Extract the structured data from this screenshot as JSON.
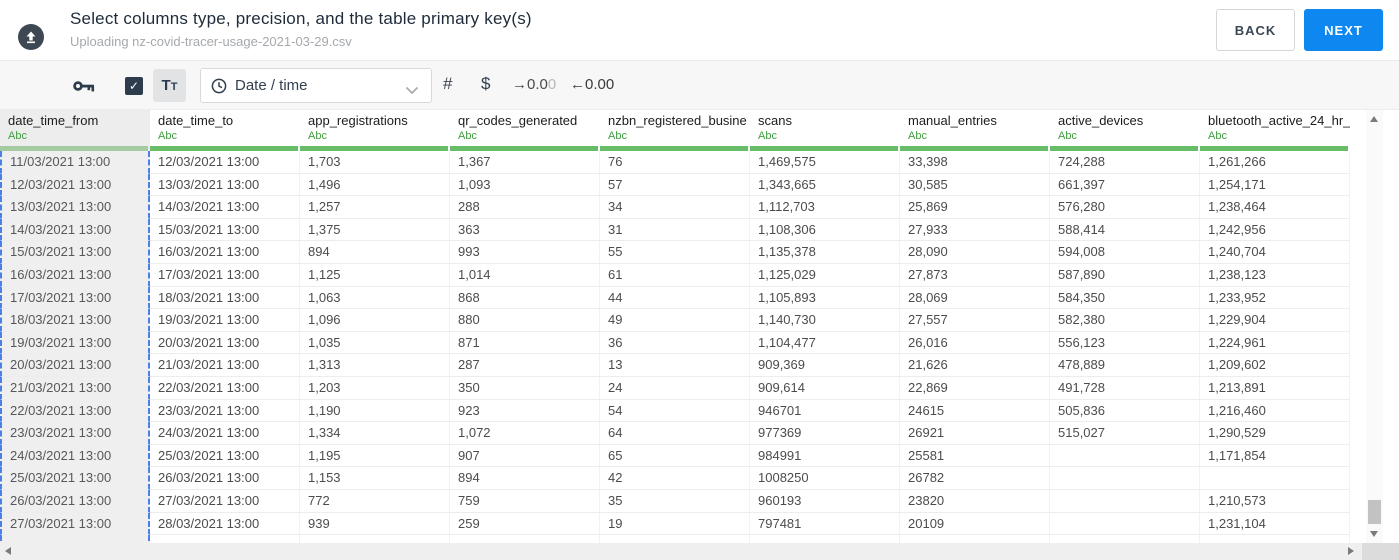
{
  "header": {
    "title": "Select columns type, precision, and the table primary key(s)",
    "subtitle": "Uploading nz-covid-tracer-usage-2021-03-29.csv",
    "back_label": "BACK",
    "next_label": "NEXT"
  },
  "toolbar": {
    "primary_key_checkbox_checked": true,
    "text_button_label": "Tt",
    "type_selector_value": "Date / time",
    "number_label": "#",
    "currency_label": "$",
    "decimal_increase_main": "→0.0",
    "decimal_increase_faded": "0",
    "decimal_decrease": "←0.00"
  },
  "icons": {
    "upload": "upload-arrow-in-circle",
    "primary_key": "key",
    "checkbox_check": "✓",
    "type_selector": "clock",
    "dropdown": "chevron-down"
  },
  "colors": {
    "accent_blue": "#0e87f1",
    "selection_blue": "#4a80e8",
    "type_green": "#3f9e3f",
    "bar_green": "#68bd68",
    "bar_green_selected": "#a5cba2",
    "dark_navy": "#2e3d4e"
  },
  "table": {
    "selected_column_index": 0,
    "columns": [
      {
        "name": "date_time_from",
        "type_label": "Abc"
      },
      {
        "name": "date_time_to",
        "type_label": "Abc"
      },
      {
        "name": "app_registrations",
        "type_label": "Abc"
      },
      {
        "name": "qr_codes_generated",
        "type_label": "Abc"
      },
      {
        "name": "nzbn_registered_busine",
        "type_label": "Abc"
      },
      {
        "name": "scans",
        "type_label": "Abc"
      },
      {
        "name": "manual_entries",
        "type_label": "Abc"
      },
      {
        "name": "active_devices",
        "type_label": "Abc"
      },
      {
        "name": "bluetooth_active_24_hr_",
        "type_label": "Abc"
      }
    ],
    "rows": [
      [
        "11/03/2021 13:00",
        "12/03/2021 13:00",
        "1,703",
        "1,367",
        "76",
        "1,469,575",
        "33,398",
        "724,288",
        "1,261,266"
      ],
      [
        "12/03/2021 13:00",
        "13/03/2021 13:00",
        "1,496",
        "1,093",
        "57",
        "1,343,665",
        "30,585",
        "661,397",
        "1,254,171"
      ],
      [
        "13/03/2021 13:00",
        "14/03/2021 13:00",
        "1,257",
        "288",
        "34",
        "1,112,703",
        "25,869",
        "576,280",
        "1,238,464"
      ],
      [
        "14/03/2021 13:00",
        "15/03/2021 13:00",
        "1,375",
        "363",
        "31",
        "1,108,306",
        "27,933",
        "588,414",
        "1,242,956"
      ],
      [
        "15/03/2021 13:00",
        "16/03/2021 13:00",
        "894",
        "993",
        "55",
        "1,135,378",
        "28,090",
        "594,008",
        "1,240,704"
      ],
      [
        "16/03/2021 13:00",
        "17/03/2021 13:00",
        "1,125",
        "1,014",
        "61",
        "1,125,029",
        "27,873",
        "587,890",
        "1,238,123"
      ],
      [
        "17/03/2021 13:00",
        "18/03/2021 13:00",
        "1,063",
        "868",
        "44",
        "1,105,893",
        "28,069",
        "584,350",
        "1,233,952"
      ],
      [
        "18/03/2021 13:00",
        "19/03/2021 13:00",
        "1,096",
        "880",
        "49",
        "1,140,730",
        "27,557",
        "582,380",
        "1,229,904"
      ],
      [
        "19/03/2021 13:00",
        "20/03/2021 13:00",
        "1,035",
        "871",
        "36",
        "1,104,477",
        "26,016",
        "556,123",
        "1,224,961"
      ],
      [
        "20/03/2021 13:00",
        "21/03/2021 13:00",
        "1,313",
        "287",
        "13",
        "909,369",
        "21,626",
        "478,889",
        "1,209,602"
      ],
      [
        "21/03/2021 13:00",
        "22/03/2021 13:00",
        "1,203",
        "350",
        "24",
        "909,614",
        "22,869",
        "491,728",
        "1,213,891"
      ],
      [
        "22/03/2021 13:00",
        "23/03/2021 13:00",
        "1,190",
        "923",
        "54",
        "946701",
        "24615",
        "505,836",
        "1,216,460"
      ],
      [
        "23/03/2021 13:00",
        "24/03/2021 13:00",
        "1,334",
        "1,072",
        "64",
        "977369",
        "26921",
        "515,027",
        "1,290,529"
      ],
      [
        "24/03/2021 13:00",
        "25/03/2021 13:00",
        "1,195",
        "907",
        "65",
        "984991",
        "25581",
        "",
        "1,171,854"
      ],
      [
        "25/03/2021 13:00",
        "26/03/2021 13:00",
        "1,153",
        "894",
        "42",
        "1008250",
        "26782",
        "",
        ""
      ],
      [
        "26/03/2021 13:00",
        "27/03/2021 13:00",
        "772",
        "759",
        "35",
        "960193",
        "23820",
        "",
        "1,210,573"
      ],
      [
        "27/03/2021 13:00",
        "28/03/2021 13:00",
        "939",
        "259",
        "19",
        "797481",
        "20109",
        "",
        "1,231,104"
      ]
    ]
  }
}
